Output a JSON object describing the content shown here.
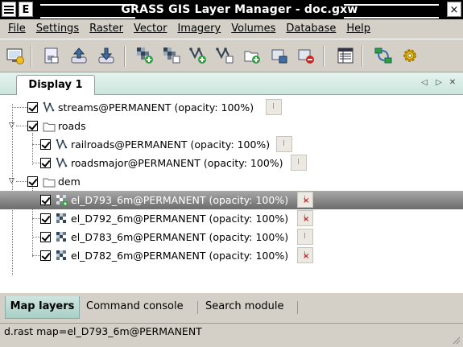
{
  "window": {
    "title": "GRASS GIS Layer Manager - doc.gxw",
    "menu_glyph": "",
    "e_glyph": "E",
    "close_glyph": "×"
  },
  "menubar": {
    "items": [
      {
        "label": "File"
      },
      {
        "label": "Settings"
      },
      {
        "label": "Raster"
      },
      {
        "label": "Vector"
      },
      {
        "label": "Imagery"
      },
      {
        "label": "Volumes"
      },
      {
        "label": "Database"
      },
      {
        "label": "Help"
      }
    ]
  },
  "toolbar": {
    "tools": [
      "new-display-icon",
      "new-workspace-icon",
      "open-workspace-icon",
      "save-workspace-icon",
      "add-raster-icon",
      "add-multiple-raster-icon",
      "add-vector-icon",
      "add-multiple-vector-icon",
      "add-group-icon",
      "add-overlay-icon",
      "remove-layer-icon",
      "attribute-table-icon",
      "modeler-icon",
      "settings-icon"
    ]
  },
  "notebook": {
    "tab_label": "Display 1",
    "nav_left": "◁",
    "nav_right": "▷",
    "nav_close": "✕"
  },
  "tree": {
    "layers": [
      {
        "label": "streams@PERMANENT (opacity: 100%)",
        "type": "vector",
        "checked": true
      },
      {
        "label": "roads",
        "type": "group",
        "checked": true,
        "expanded": true
      },
      {
        "label": "railroads@PERMANENT (opacity: 100%)",
        "type": "vector",
        "checked": true
      },
      {
        "label": "roadsmajor@PERMANENT (opacity: 100%)",
        "type": "vector",
        "checked": true
      },
      {
        "label": "dem",
        "type": "group",
        "checked": true,
        "expanded": true
      },
      {
        "label": "el_D793_6m@PERMANENT (opacity: 100%)",
        "type": "raster",
        "checked": true,
        "selected": true
      },
      {
        "label": "el_D792_6m@PERMANENT (opacity: 100%)",
        "type": "raster",
        "checked": true
      },
      {
        "label": "el_D783_6m@PERMANENT (opacity: 100%)",
        "type": "raster",
        "checked": true
      },
      {
        "label": "el_D782_6m@PERMANENT (opacity: 100%)",
        "type": "raster",
        "checked": true
      }
    ]
  },
  "bottom_tabs": [
    {
      "label": "Map layers",
      "active": true
    },
    {
      "label": "Command console"
    },
    {
      "label": "Search module"
    }
  ],
  "status": {
    "text": "d.rast map=el_D793_6m@PERMANENT"
  },
  "colors": {
    "selection": "#7a7a7a",
    "tab_green": "#cbe6dd",
    "raster_blue": "#3a5a8c",
    "add_green": "#2e9e3e",
    "remove_red": "#cc2222"
  }
}
